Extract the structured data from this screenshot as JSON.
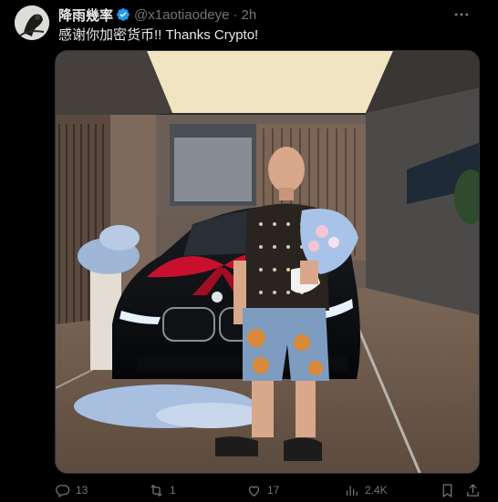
{
  "tweet": {
    "display_name": "降雨幾率",
    "handle": "@x1aotiaodeye",
    "separator": "·",
    "time": "2h",
    "text": "感谢你加密货币!! Thanks Crypto!"
  },
  "actions": {
    "replies": "13",
    "retweets": "1",
    "likes": "17",
    "views": "2.4K"
  },
  "icons": {
    "verified": "verified-badge-icon",
    "more": "more-horizontal-icon",
    "reply": "reply-icon",
    "retweet": "retweet-icon",
    "like": "heart-icon",
    "views": "views-chart-icon",
    "bookmark": "bookmark-icon",
    "share": "share-icon"
  },
  "colors": {
    "background": "#000000",
    "text": "#e7e9ea",
    "secondary": "#71767b",
    "verified": "#1d9bf0",
    "ribbon": "#c8102e"
  }
}
